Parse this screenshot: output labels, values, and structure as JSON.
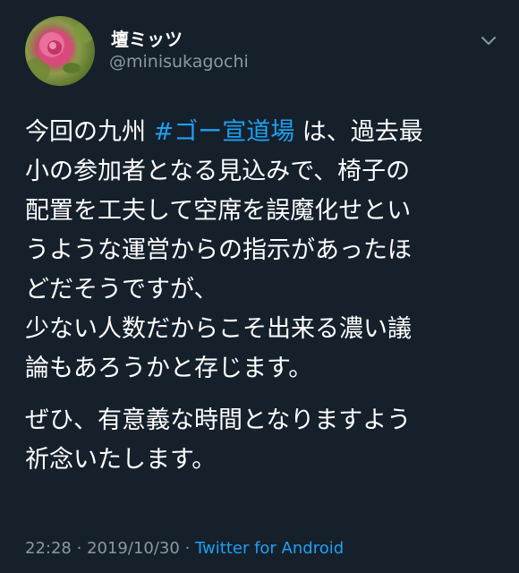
{
  "user": {
    "display_name": "壇ミッツ",
    "handle": "@minisukagochi",
    "avatar_icon": "rose-flower-avatar"
  },
  "menu": {
    "icon": "chevron-down-icon"
  },
  "tweet": {
    "line1_prefix": "今回の九州 ",
    "hashtag": "#ゴー宣道場",
    "line1_suffix": " は、過去最",
    "line2": "小の参加者となる見込みで、椅子の",
    "line3": "配置を工夫して空席を誤魔化せとい",
    "line4": "うような運営からの指示があったほ",
    "line5": "どだそうですが、",
    "line6": "少ない人数だからこそ出来る濃い議",
    "line7": "論もあろうかと存じます。",
    "line8": "ぜひ、有意義な時間となりますよう",
    "line9": "祈念いたします。"
  },
  "meta": {
    "time": "22:28",
    "separator": "·",
    "date": "2019/10/30",
    "client": "Twitter for Android"
  },
  "colors": {
    "background": "#15202b",
    "text": "#ffffff",
    "secondary": "#8899a6",
    "accent": "#1da1f2"
  }
}
